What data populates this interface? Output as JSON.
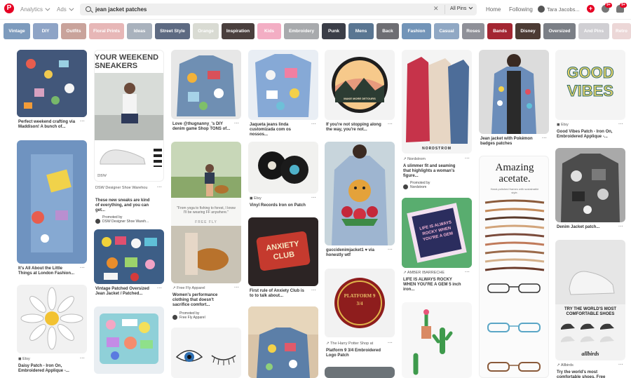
{
  "header": {
    "analytics_label": "Analytics",
    "ads_label": "Ads",
    "search_value": "jean jacket patches",
    "search_placeholder": "Search",
    "scope_label": "All Pins",
    "home_label": "Home",
    "following_label": "Following",
    "user_name": "Tara Jacobs...",
    "messages_badge": "9+",
    "notifications_badge": "9+",
    "brand_color": "#e60023"
  },
  "guides": [
    {
      "label": "Vintage",
      "color": "#7d9bbd"
    },
    {
      "label": "DIY",
      "color": "#8ea4c6"
    },
    {
      "label": "Outfits",
      "color": "#c9a39b"
    },
    {
      "label": "Floral Prints",
      "color": "#e7b7b7"
    },
    {
      "label": "Ideas",
      "color": "#a9b2bd"
    },
    {
      "label": "Street Style",
      "color": "#5d6a82"
    },
    {
      "label": "Orange",
      "color": "#d9dbd3"
    },
    {
      "label": "Inspiration",
      "color": "#4a3f3d"
    },
    {
      "label": "Kids",
      "color": "#f3aec4"
    },
    {
      "label": "Embroidery",
      "color": "#a8aaad"
    },
    {
      "label": "Punk",
      "color": "#3b3e48"
    },
    {
      "label": "Mens",
      "color": "#5a7692"
    },
    {
      "label": "Back",
      "color": "#6e6e73"
    },
    {
      "label": "Fashion",
      "color": "#7294b8"
    },
    {
      "label": "Casual",
      "color": "#90a8c4"
    },
    {
      "label": "Roses",
      "color": "#8f9098"
    },
    {
      "label": "Bands",
      "color": "#a32632"
    },
    {
      "label": "Disney",
      "color": "#4c3b34"
    },
    {
      "label": "Oversized",
      "color": "#7b7f86"
    },
    {
      "label": "And Pins",
      "color": "#d0cfd3"
    },
    {
      "label": "Retro",
      "color": "#ecd7d7"
    }
  ],
  "pins": {
    "c1p1": {
      "title": "Perfect weekend crafting via Maddison! A bunch of..."
    },
    "c1p2": {
      "title": "It's All About the Little Things at London Fashion..."
    },
    "c1p3": {
      "source": "Etsy",
      "title": "Daisy Patch - Iron On, Embroidered Applique -..."
    },
    "c2p1": {
      "image_heading": "YOUR WEEKEND SNEAKERS",
      "image_brand": "DSW",
      "advertiser": "DSW Designer Shoe Warehou",
      "title": "These new sneaks are kind of everything, and you can get...",
      "promoted_label": "Promoted by",
      "promoted_by": "DSW Designer Shoe Wareh..."
    },
    "c2p2": {
      "title": "Vintage Patched Oversized Jean Jacket / Patched..."
    },
    "c3p1": {
      "title": "Love @thugnanny_'s DIY denim game Shop TONS of..."
    },
    "c3p2": {
      "quote": "\"From yoga to fishing to forest, I know I'll be wearing FF anywhere.\"",
      "brand_watermark": "FREE FLY",
      "advertiser": "Free Fly Apparel",
      "title": "Women's performance clothing that doesn't sacrifice comfort...",
      "promoted_label": "Promoted by",
      "promoted_by": "Free Fly Apparel"
    },
    "c4p1": {
      "title": "Jaqueta jeans linda customizada com os nossos..."
    },
    "c4p2": {
      "source": "Etsy",
      "title": "Vinyl Records Iron on Patch"
    },
    "c4p3": {
      "patch_text": "ANXIETY CLUB",
      "title": "First rule of Anxiety Club is to to talk about..."
    },
    "c5p1": {
      "patch_text": "MAKE MORE DETOURS",
      "title": "If you're not stopping along the way, you're not..."
    },
    "c5p2": {
      "title": "guccidenimjacket1 ♥ via honestly wtf"
    },
    "c5p3": {
      "patch_text": "PLATFORM 9 3/4",
      "source": "The Harry Potter Shop at",
      "title": "Platform 9 3/4 Embroidered Logo Patch"
    },
    "c6p1": {
      "brand_watermark": "NORDSTROM",
      "source": "Nordstrom",
      "title": "A slimmer fit and seaming that highlights a woman's figure...",
      "promoted_label": "Promoted by",
      "promoted_by": "Nordstrom"
    },
    "c6p2": {
      "patch_text": "LIFE IS ALWAYS ROCKY WHEN YOU'RE A GEM",
      "source": "AMBER IBARRECHE",
      "title": "LIFE IS ALWAYS ROCKY WHEN YOU'RE A GEM 5 inch iron..."
    },
    "c7p1": {
      "title": "Jean jacket with Pokémon badges patches"
    },
    "c7p2": {
      "image_heading": "Amazing acetate.",
      "image_sub": "Hand-polished frames with sustainable style."
    },
    "c8p1": {
      "patch_text": "GOOD VIBES",
      "source": "Etsy",
      "title": "Good Vibes Patch - Iron On, Embroidered Applique -..."
    },
    "c8p2": {
      "title": "Denim Jacket patch..."
    },
    "c8p3": {
      "image_heading": "TRY THE WORLD'S MOST COMFORTABLE SHOES",
      "image_brand": "allbirds",
      "source": "Allbirds",
      "title": "Try the world's most comfortable shoes. Free ship..."
    }
  }
}
